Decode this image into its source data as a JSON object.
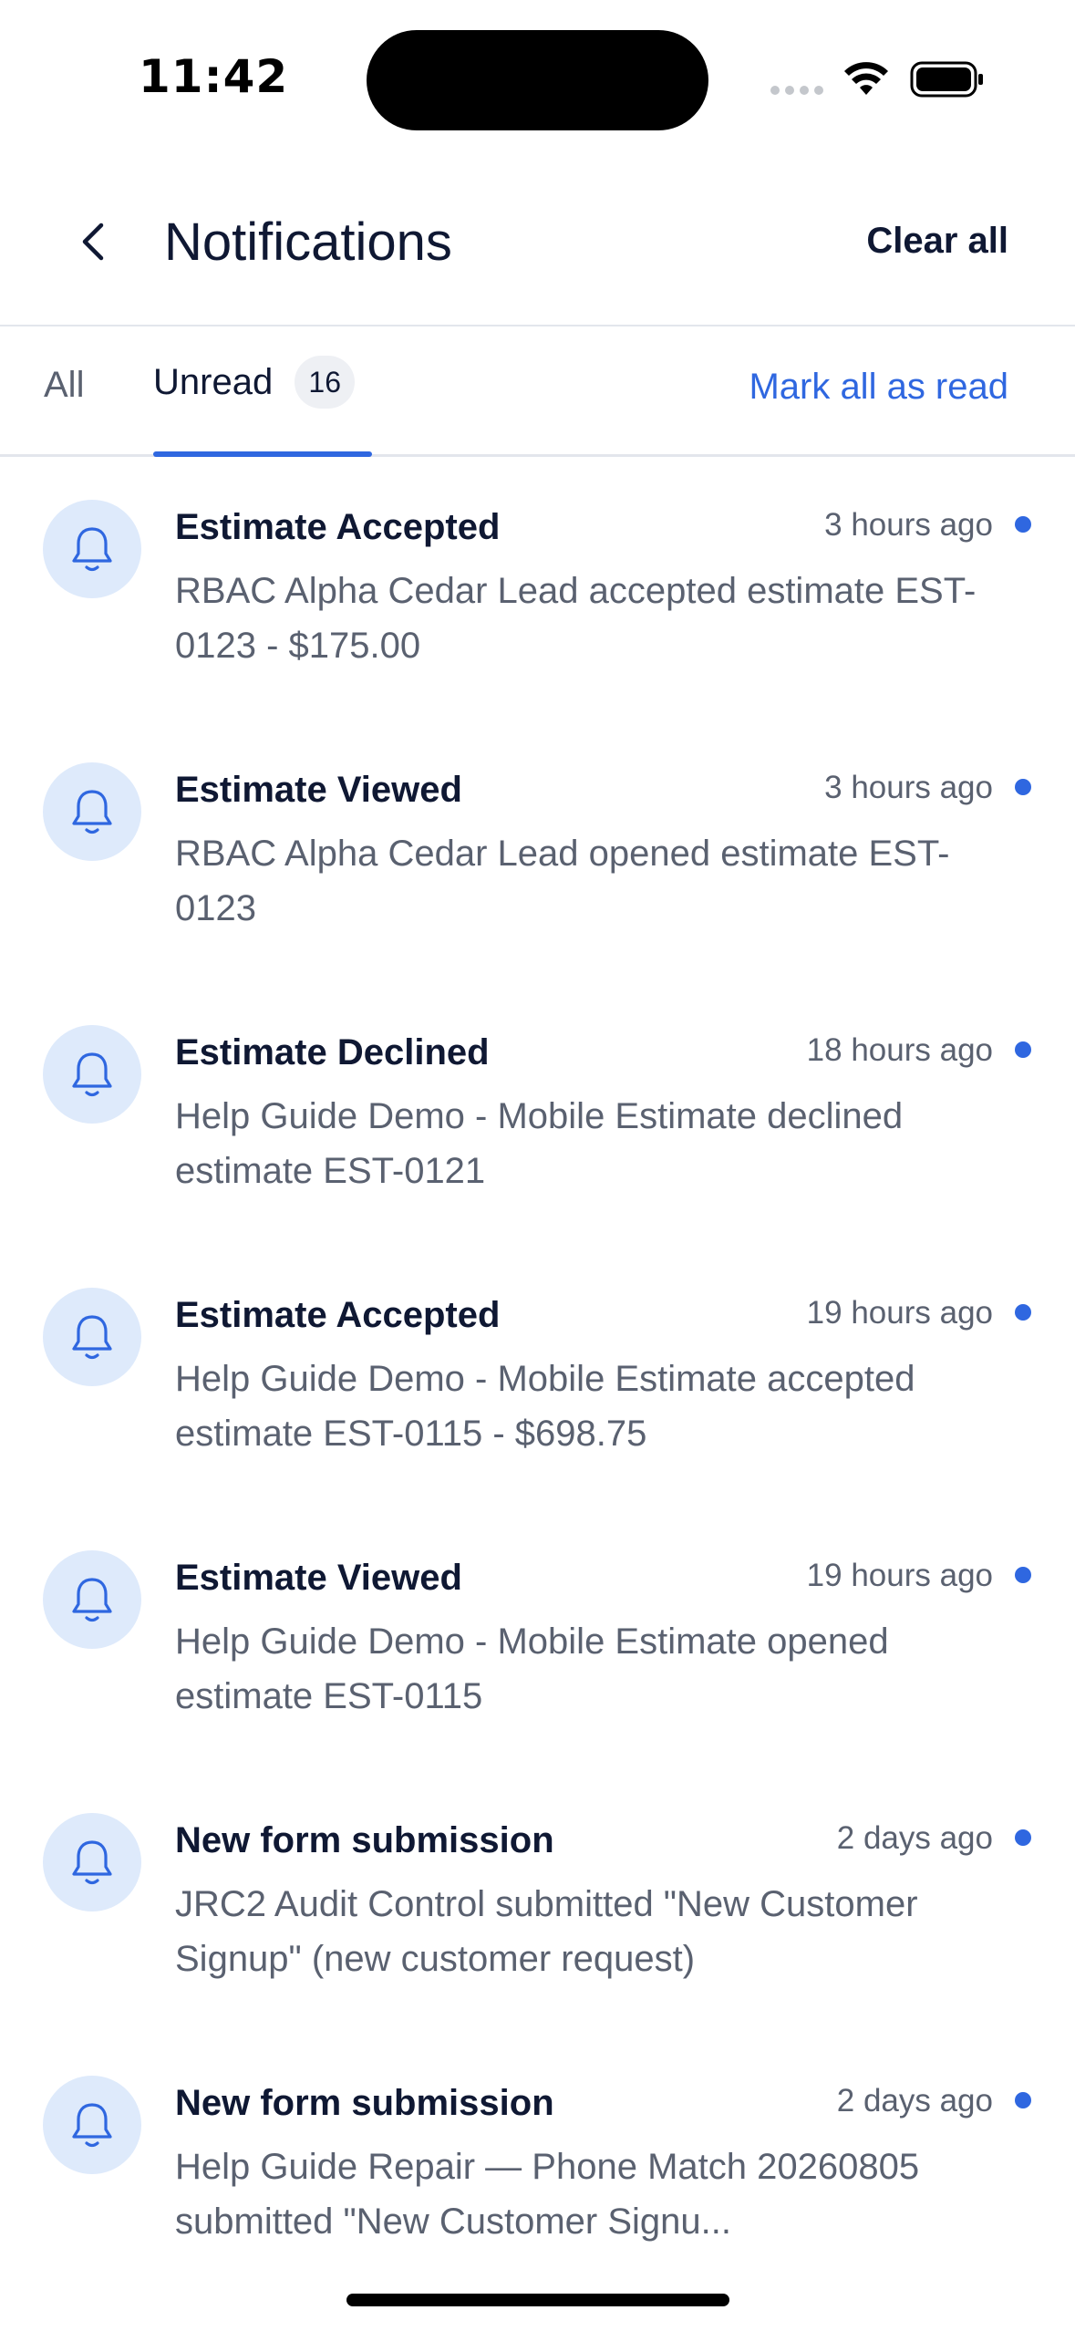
{
  "status_bar": {
    "time": "11:42"
  },
  "header": {
    "title": "Notifications",
    "clear_all_label": "Clear all"
  },
  "tabs": {
    "all_label": "All",
    "unread_label": "Unread",
    "unread_count": "16",
    "mark_all_read_label": "Mark all as read"
  },
  "colors": {
    "accent": "#2f67e0",
    "icon_background": "#deeafb",
    "text_primary": "#0f1833",
    "text_secondary": "#5a6170"
  },
  "notifications": [
    {
      "icon": "bell-icon",
      "title": "Estimate Accepted",
      "time": "3 hours ago",
      "body": "RBAC Alpha Cedar Lead accepted estimate EST-0123 - $175.00",
      "unread": true
    },
    {
      "icon": "bell-icon",
      "title": "Estimate Viewed",
      "time": "3 hours ago",
      "body": "RBAC Alpha Cedar Lead opened estimate EST-0123",
      "unread": true
    },
    {
      "icon": "bell-icon",
      "title": "Estimate Declined",
      "time": "18 hours ago",
      "body": "Help Guide Demo - Mobile Estimate declined estimate EST-0121",
      "unread": true
    },
    {
      "icon": "bell-icon",
      "title": "Estimate Accepted",
      "time": "19 hours ago",
      "body": "Help Guide Demo - Mobile Estimate accepted estimate EST-0115 - $698.75",
      "unread": true
    },
    {
      "icon": "bell-icon",
      "title": "Estimate Viewed",
      "time": "19 hours ago",
      "body": "Help Guide Demo - Mobile Estimate opened estimate EST-0115",
      "unread": true
    },
    {
      "icon": "bell-icon",
      "title": "New form submission",
      "time": "2 days ago",
      "body": "JRC2 Audit Control submitted \"New Customer Signup\" (new customer request)",
      "unread": true
    },
    {
      "icon": "bell-icon",
      "title": "New form submission",
      "time": "2 days ago",
      "body": "Help Guide Repair — Phone Match 20260805 submitted \"New Customer Signu...",
      "unread": true
    }
  ]
}
